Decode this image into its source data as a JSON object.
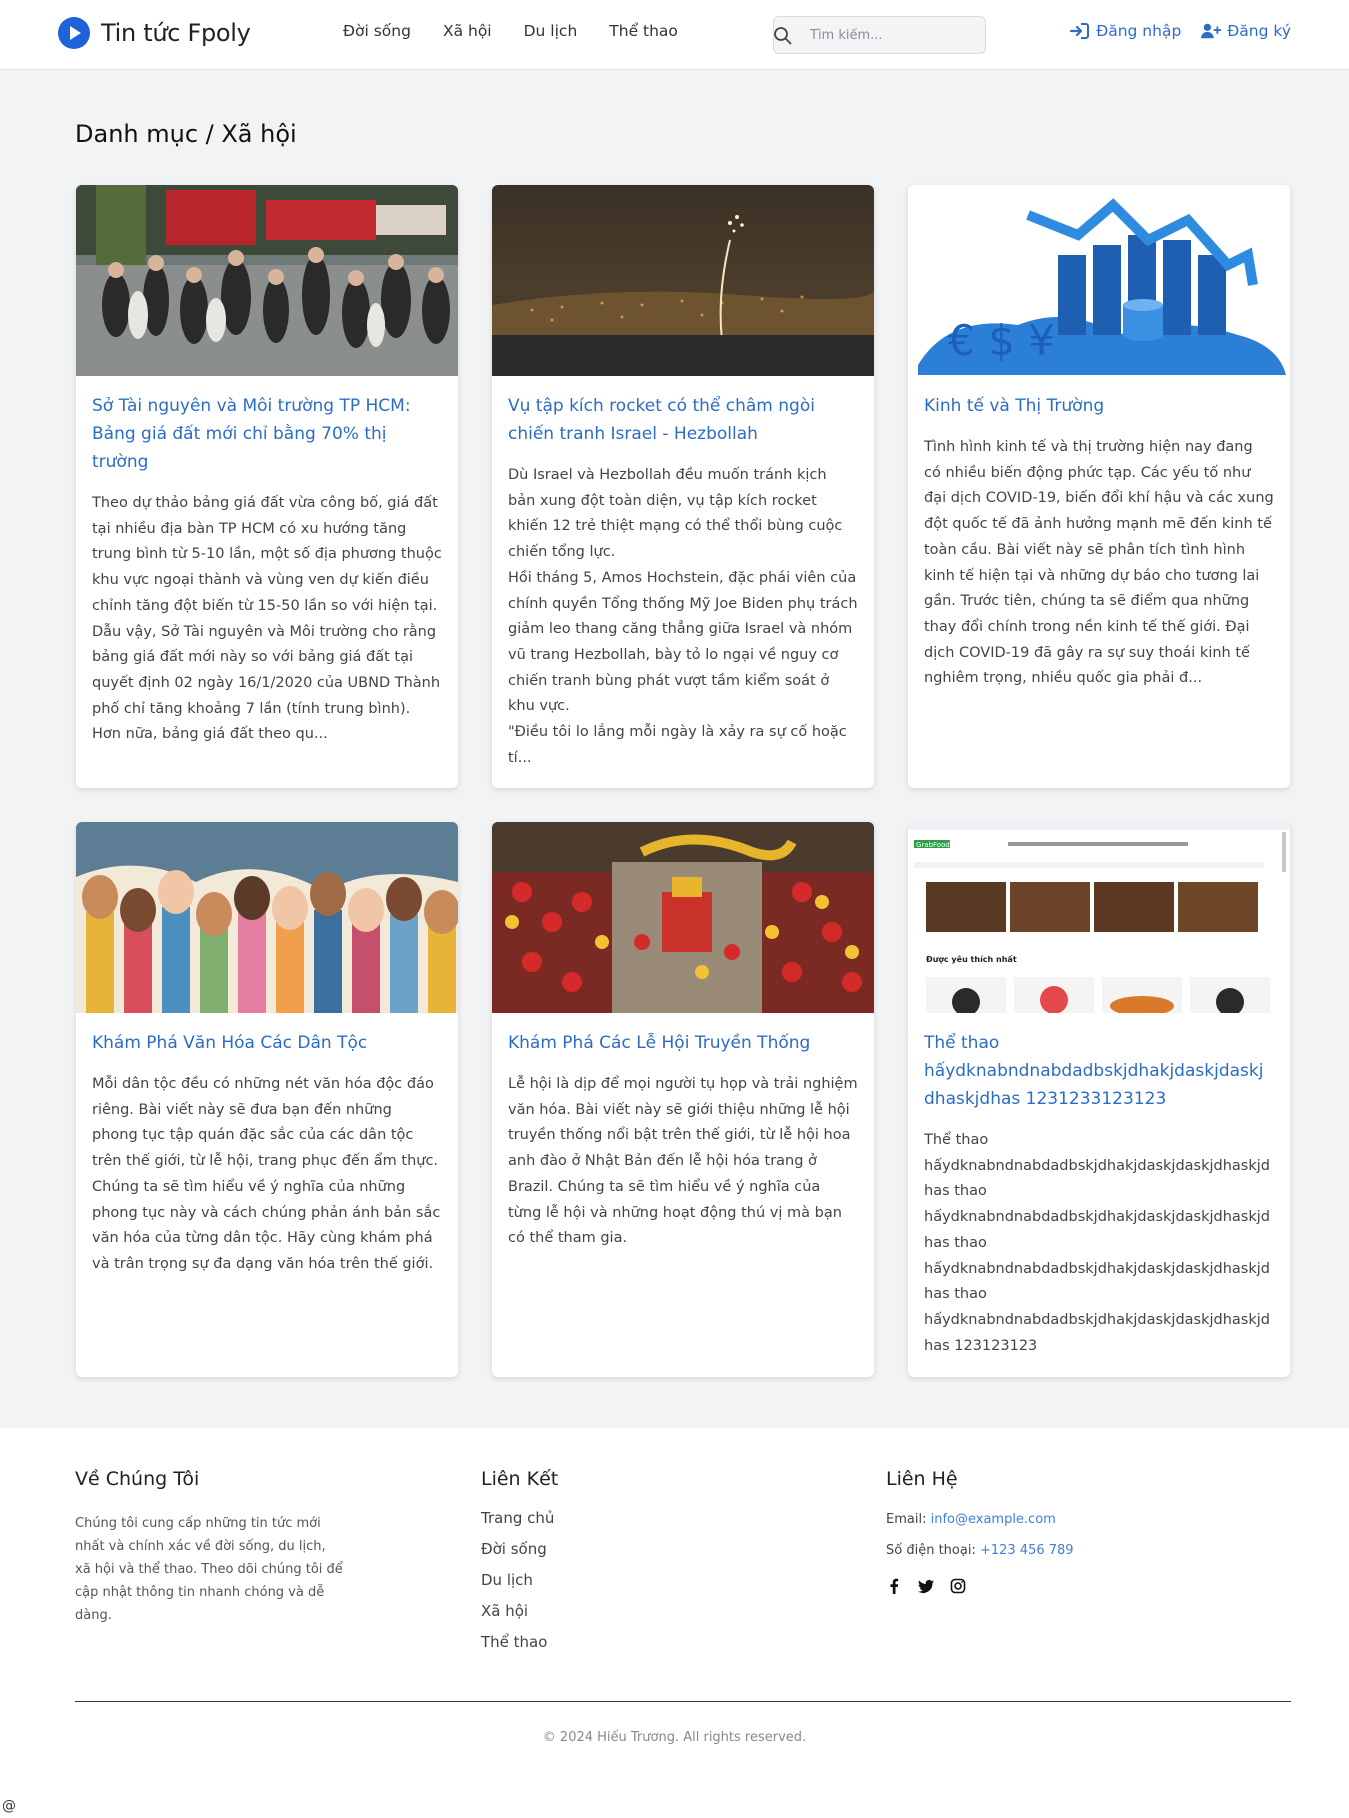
{
  "brand": {
    "name": "Tin tức Fpoly"
  },
  "nav": [
    "Đời sống",
    "Xã hội",
    "Du lịch",
    "Thể thao"
  ],
  "search": {
    "placeholder": "Tìm kiếm..."
  },
  "auth": {
    "login": "Đăng nhập",
    "register": "Đăng ký"
  },
  "page_title": "Danh mục / Xã hội",
  "articles": [
    {
      "title": "Sở Tài nguyên và Môi trường TP HCM: Bảng giá đất mới chỉ bằng 70% thị trường",
      "excerpt": "Theo dự thảo bảng giá đất vừa công bố, giá đất tại nhiều địa bàn TP HCM có xu hướng tăng trung bình từ 5-10 lần, một số địa phương thuộc khu vực ngoại thành và vùng ven dự kiến điều chỉnh tăng đột biến từ 15-50 lần so với hiện tại. Dẫu vậy, Sở Tài nguyên và Môi trường cho rằng bảng giá đất mới này so với bảng giá đất tại quyết định 02 ngày 16/1/2020 của UBND Thành phố chỉ tăng khoảng 7 lần (tính trung bình). Hơn nữa, bảng giá đất theo qu...",
      "image": "street-crowd-photo"
    },
    {
      "title": "Vụ tập kích rocket có thể châm ngòi chiến tranh Israel - Hezbollah",
      "excerpt": "Dù Israel và Hezbollah đều muốn tránh kịch bản xung đột toàn diện, vụ tập kích rocket khiến 12 trẻ thiệt mạng có thể thổi bùng cuộc chiến tổng lực.\nHồi tháng 5, Amos Hochstein, đặc phái viên của chính quyền Tổng thống Mỹ Joe Biden phụ trách giảm leo thang căng thẳng giữa Israel và nhóm vũ trang Hezbollah, bày tỏ lo ngại về nguy cơ chiến tranh bùng phát vượt tầm kiểm soát ở khu vực.\n\"Điều tôi lo lắng mỗi ngày là xảy ra sự cố hoặc tí...",
      "image": "night-rocket-photo"
    },
    {
      "title": "Kinh tế và Thị Trường",
      "excerpt": "Tình hình kinh tế và thị trường hiện nay đang có nhiều biến động phức tạp. Các yếu tố như đại dịch COVID-19, biến đổi khí hậu và các xung đột quốc tế đã ảnh hưởng mạnh mẽ đến kinh tế toàn cầu. Bài viết này sẽ phân tích tình hình kinh tế hiện tại và những dự báo cho tương lai gần. Trước tiên, chúng ta sẽ điểm qua những thay đổi chính trong nền kinh tế thế giới. Đại dịch COVID-19 đã gây ra sự suy thoái kinh tế nghiêm trọng, nhiều quốc gia phải đ...",
      "image": "global-economy-graphic"
    },
    {
      "title": "Khám Phá Văn Hóa Các Dân Tộc",
      "excerpt": "Mỗi dân tộc đều có những nét văn hóa độc đáo riêng. Bài viết này sẽ đưa bạn đến những phong tục tập quán đặc sắc của các dân tộc trên thế giới, từ lễ hội, trang phục đến ẩm thực. Chúng ta sẽ tìm hiểu về ý nghĩa của những phong tục này và cách chúng phản ánh bản sắc văn hóa của từng dân tộc. Hãy cùng khám phá và trân trọng sự đa dạng văn hóa trên thế giới.",
      "image": "raised-hands-illustration"
    },
    {
      "title": "Khám Phá Các Lễ Hội Truyền Thống",
      "excerpt": "Lễ hội là dịp để mọi người tụ họp và trải nghiệm văn hóa. Bài viết này sẽ giới thiệu những lễ hội truyền thống nổi bật trên thế giới, từ lễ hội hoa anh đào ở Nhật Bản đến lễ hội hóa trang ở Brazil. Chúng ta sẽ tìm hiểu về ý nghĩa của từng lễ hội và những hoạt động thú vị mà bạn có thể tham gia.",
      "image": "festival-parade-photo"
    },
    {
      "title": "Thể thao hấydknabndnabdadbskjdhakjdaskjdaskjdhaskjdhas 1231233123123",
      "excerpt": "Thể thao hấydknabndnabdadbskjdhakjdaskjdaskjdhaskjdhas thao hấydknabndnabdadbskjdhakjdaskjdaskjdhaskjdhas thao hấydknabndnabdadbskjdhakjdaskjdaskjdhaskjdhas thao hấydknabndnabdadbskjdhakjdaskjdaskjdhaskjdhas 123123123",
      "image": "food-website-screenshot"
    }
  ],
  "thumb_labels": {
    "food_logo": "GrabFood",
    "food_section": "Được yêu thích nhất"
  },
  "footer": {
    "about": {
      "heading": "Về Chúng Tôi",
      "text": "Chúng tôi cung cấp những tin tức mới nhất và chính xác về đời sống, du lịch, xã hội và thể thao. Theo dõi chúng tôi để cập nhật thông tin nhanh chóng và dễ dàng."
    },
    "links": {
      "heading": "Liên Kết",
      "items": [
        "Trang chủ",
        "Đời sống",
        "Du lịch",
        "Xã hội",
        "Thể thao"
      ]
    },
    "contact": {
      "heading": "Liên Hệ",
      "email_label": "Email:",
      "email": "info@example.com",
      "phone_label": "Số điện thoại:",
      "phone": "+123 456 789",
      "socials": [
        "facebook-icon",
        "twitter-icon",
        "instagram-icon"
      ]
    },
    "copyright": "© 2024 Hiếu Trương. All rights reserved."
  },
  "corner_mark": "@",
  "colors": {
    "accent": "#2b6cc4",
    "brand_logo": "#1f63d8",
    "page_bg": "#f2f3f5"
  }
}
